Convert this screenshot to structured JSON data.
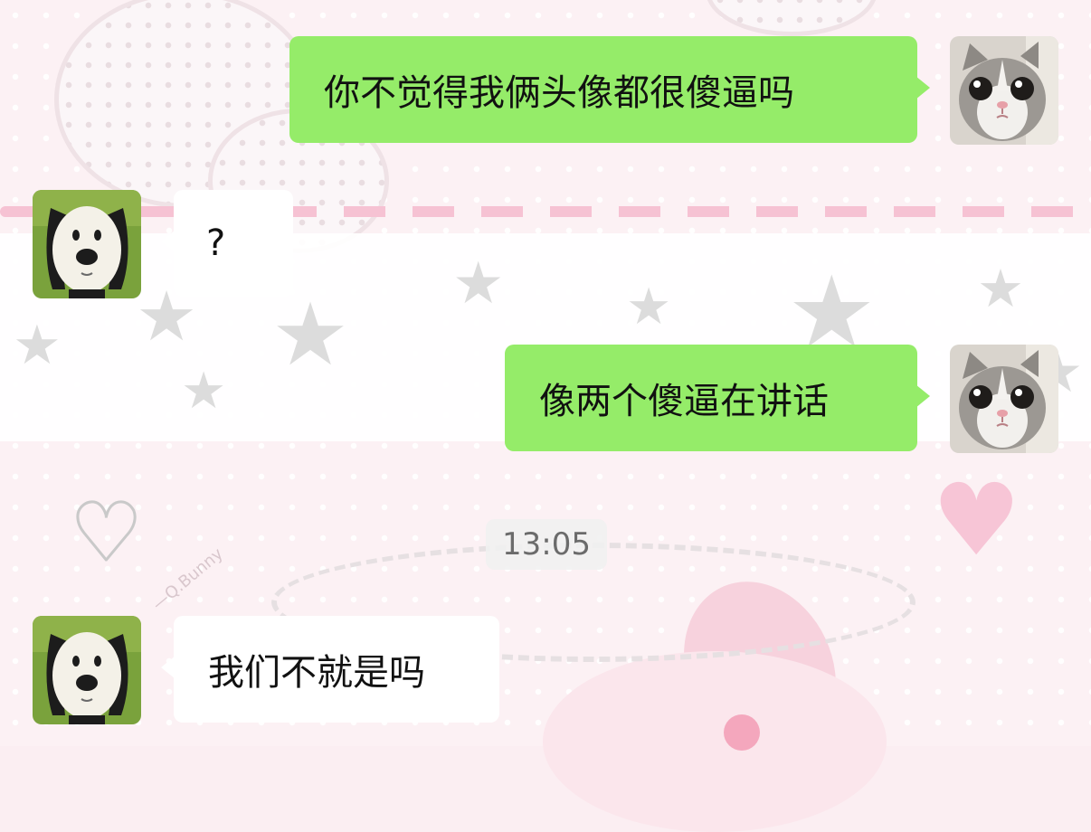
{
  "messages": [
    {
      "sender": "me",
      "avatar_icon": "kitten-avatar-icon",
      "text": "你不觉得我俩头像都很傻逼吗"
    },
    {
      "sender": "other",
      "avatar_icon": "cartoon-dog-avatar-icon",
      "text": "?"
    },
    {
      "sender": "me",
      "avatar_icon": "kitten-avatar-icon",
      "text": "像两个傻逼在讲话"
    },
    {
      "sender": "other",
      "avatar_icon": "cartoon-dog-avatar-icon",
      "text": "我们不就是吗"
    }
  ],
  "timestamp": "13:05",
  "wallpaper_watermark": "—Q.Bunny",
  "colors": {
    "my_bubble": "#95ec69",
    "their_bubble": "#ffffff",
    "timestamp_bg": "#f0f0f0",
    "wallpaper": "#fcf1f4"
  }
}
